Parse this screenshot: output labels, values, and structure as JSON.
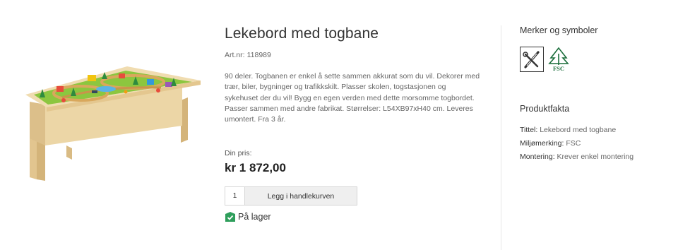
{
  "product": {
    "title": "Lekebord med togbane",
    "art_label": "Art.nr:",
    "art_number": "118989",
    "description": "90 deler. Togbanen er enkel å sette sammen akkurat som du vil. Dekorer med trær, biler, bygninger og trafikkskilt. Plasser skolen, togstasjonen og sykehuset der du vil! Bygg en egen verden med dette morsomme togbordet. Passer sammen med andre fabrikat. Størrelser: L54XB97xH40 cm. Leveres umontert. Fra 3 år.",
    "price_label": "Din pris:",
    "price": "kr 1 872,00",
    "quantity": "1",
    "add_to_cart_label": "Legg i handlekurven",
    "stock_status": "På lager"
  },
  "sidebar": {
    "badges_title": "Merker og symboler",
    "badges": [
      {
        "icon": "tools-icon"
      },
      {
        "icon": "fsc-icon",
        "label": "FSC"
      }
    ],
    "facts_title": "Produktfakta",
    "facts": [
      {
        "key": "Tittel:",
        "value": "Lekebord med togbane"
      },
      {
        "key": "Miljømerking:",
        "value": "FSC"
      },
      {
        "key": "Montering:",
        "value": "Krever enkel montering"
      }
    ]
  },
  "colors": {
    "stock_green": "#2e9e5b",
    "button_bg": "#efefef",
    "wood": "#e8cf9c"
  }
}
